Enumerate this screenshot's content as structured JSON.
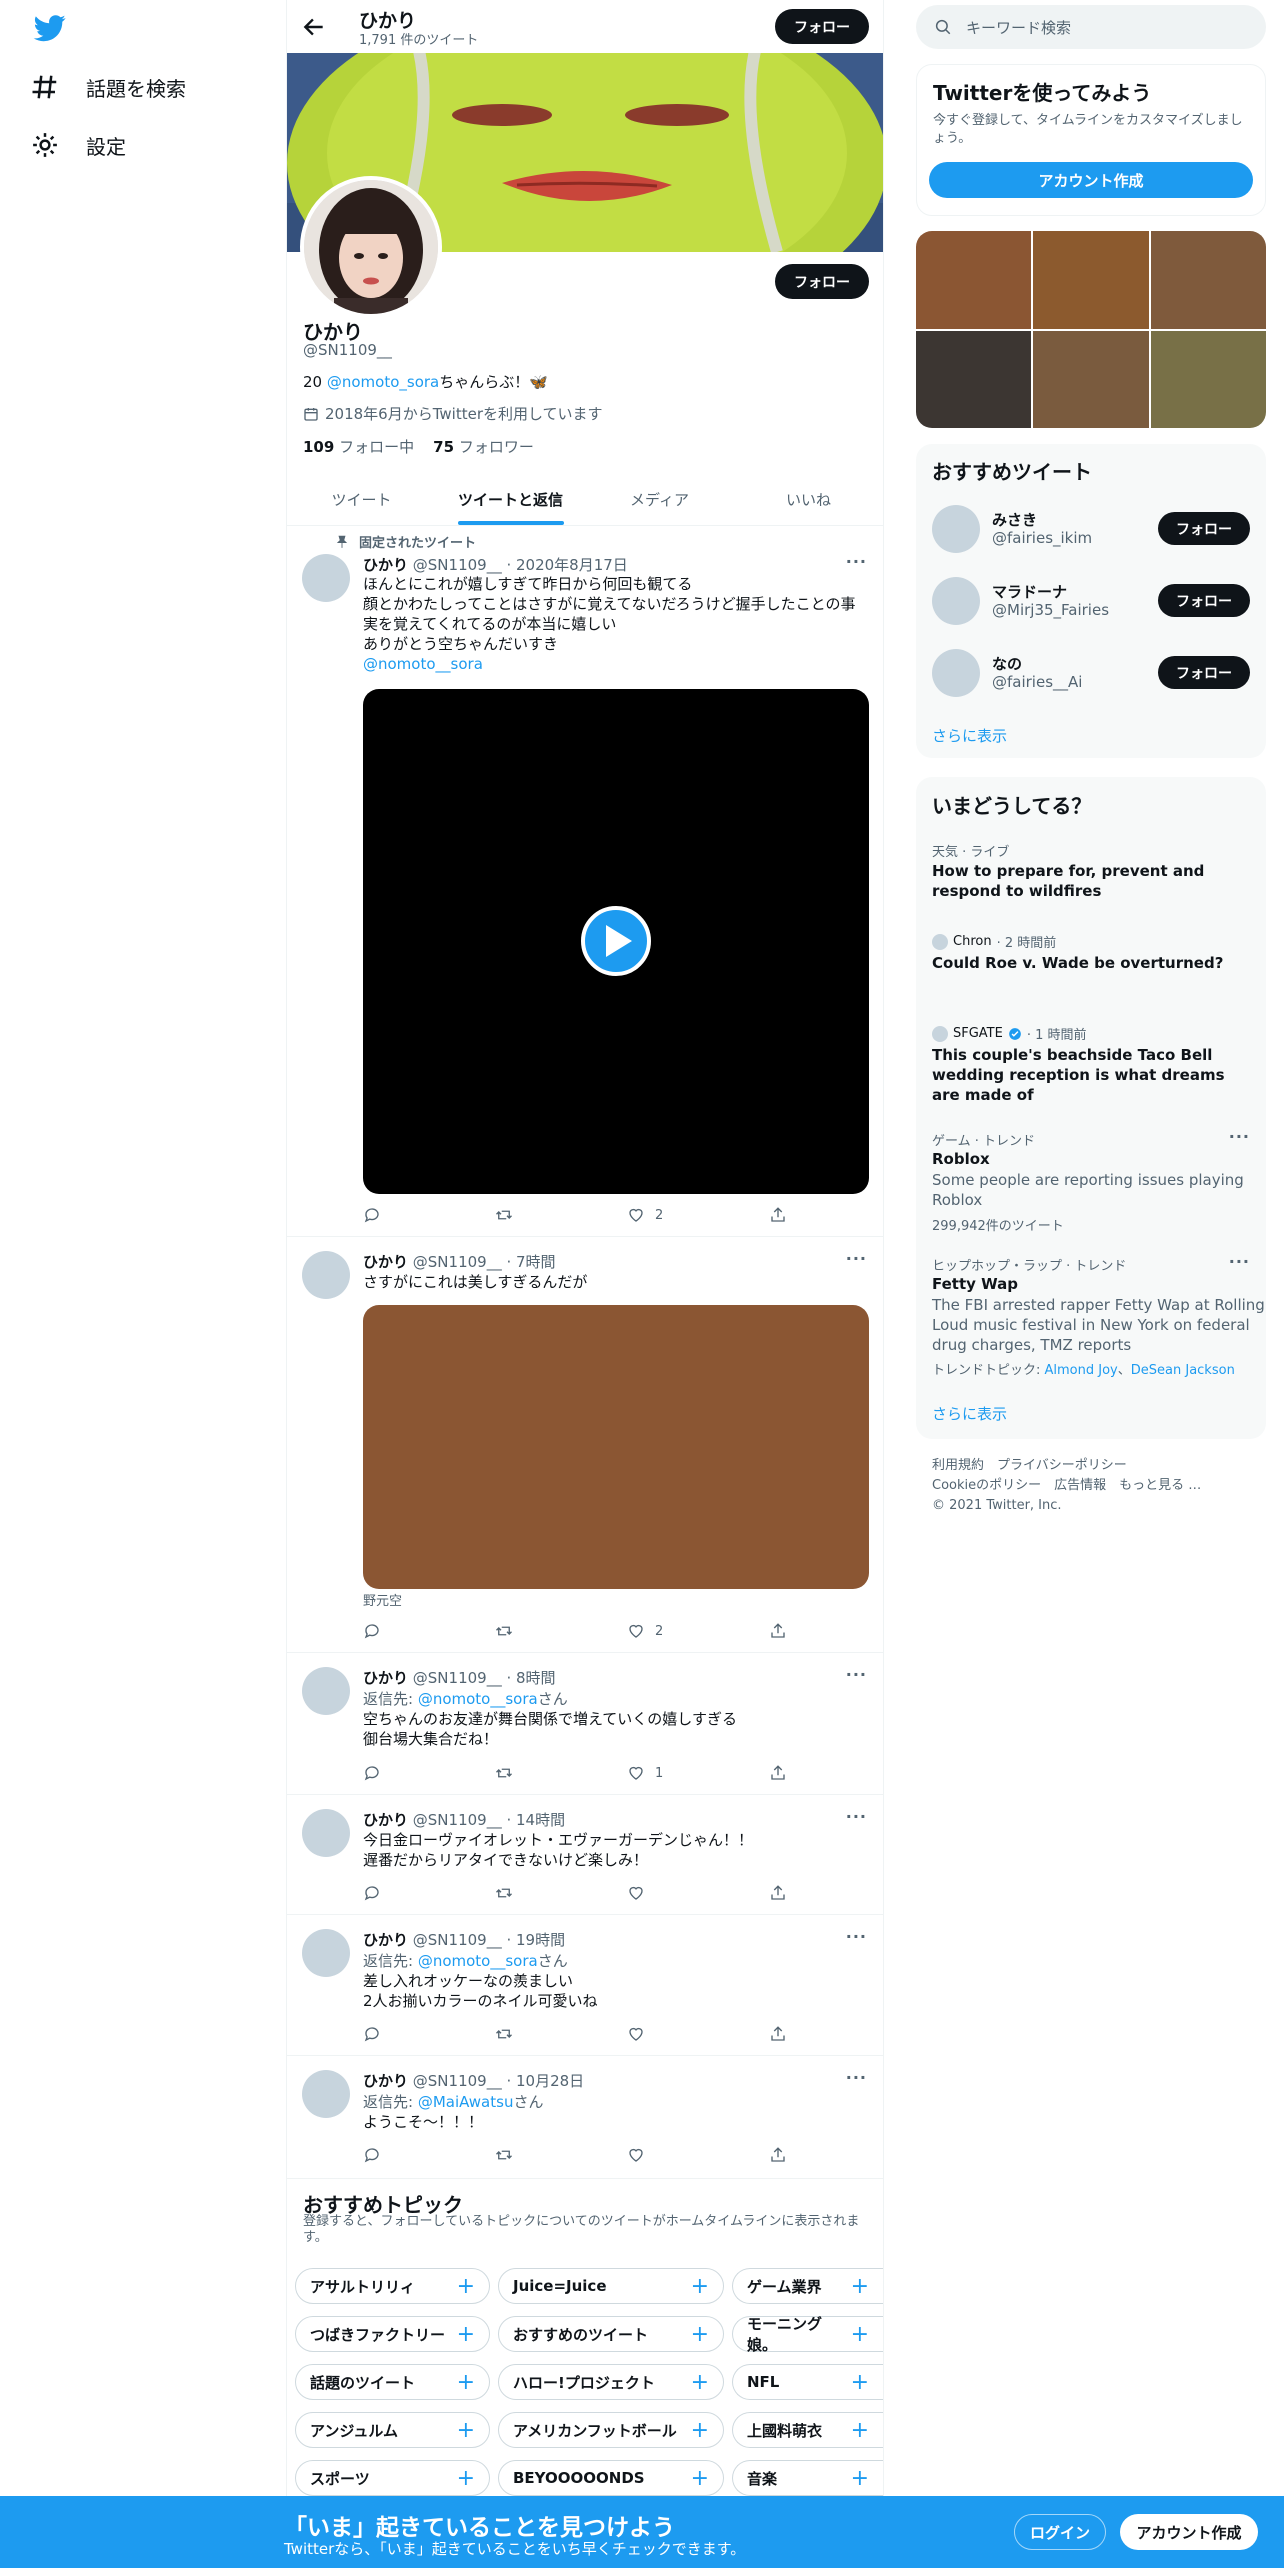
{
  "left_nav": {
    "items": [
      {
        "icon": "hashtag-icon",
        "label": "話題を検索"
      },
      {
        "icon": "gear-icon",
        "label": "設定"
      }
    ]
  },
  "header": {
    "name": "ひかり",
    "tweet_count": "1,791 件のツイート",
    "follow_label": "フォロー"
  },
  "profile": {
    "name": "ひかり",
    "handle": "@SN1109__",
    "bio_prefix": "20 ",
    "bio_mention": "@nomoto_sora",
    "bio_suffix": "ちゃんらぶ！🦋",
    "joined": "2018年6月からTwitterを利用しています",
    "following_count": "109",
    "following_label": " フォロー中",
    "followers_count": "75",
    "followers_label": " フォロワー",
    "follow_label": "フォロー"
  },
  "tabs": [
    "ツイート",
    "ツイートと返信",
    "メディア",
    "いいね"
  ],
  "pinned_label": "固定されたツイート",
  "tweets": [
    {
      "name": "ひかり",
      "meta": " @SN1109__ · 2020年8月17日",
      "text": "ほんとにこれが嬉しすぎて昨日から何回も観てる\n顔とかわたしってことはさすがに覚えてないだろうけど握手したことの事\n実を覚えてくれてるのが本当に嬉しい\nありがとう空ちゃんだいすき",
      "link": "@nomoto__sora",
      "likes": "2"
    },
    {
      "name": "ひかり",
      "meta": " @SN1109__ · 7時間",
      "text": "さすがにこれは美しすぎるんだが",
      "caption": "野元空",
      "likes": "2"
    },
    {
      "name": "ひかり",
      "meta": " @SN1109__ · 8時間",
      "reply_prefix": "返信先: ",
      "reply_to": "@nomoto__sora",
      "reply_suffix": "さん",
      "text": "空ちゃんのお友達が舞台関係で増えていくの嬉しすぎる\n御台場大集合だね！",
      "likes": "1"
    },
    {
      "name": "ひかり",
      "meta": " @SN1109__ · 14時間",
      "text": "今日金ローヴァイオレット・エヴァーガーデンじゃん！！\n遅番だからリアタイできないけど楽しみ！"
    },
    {
      "name": "ひかり",
      "meta": " @SN1109__ · 19時間",
      "reply_prefix": "返信先: ",
      "reply_to": "@nomoto__sora",
      "reply_suffix": "さん",
      "text": "差し入れオッケーなの羨ましい\n2人お揃いカラーのネイル可愛いね"
    },
    {
      "name": "ひかり",
      "meta": " @SN1109__ · 10月28日",
      "reply_prefix": "返信先: ",
      "reply_to": "@MaiAwatsu",
      "reply_suffix": "さん",
      "text": "ようこそ〜！！！"
    }
  ],
  "topics": {
    "title": "おすすめトピック",
    "subtitle": "登録すると、フォローしているトピックについてのツイートがホームタイムラインに表示されます。",
    "items": [
      "アサルトリリィ",
      "Juice=Juice",
      "ゲーム業界",
      "つばきファクトリー",
      "おすすめのツイート",
      "モーニング娘。",
      "話題のツイート",
      "ハロー!プロジェクト",
      "NFL",
      "アンジュルム",
      "アメリカンフットボール",
      "上國料萌衣",
      "スポーツ",
      "BEYOOOOONDS",
      "音楽"
    ]
  },
  "right": {
    "search_placeholder": "キーワード検索",
    "signup_title": "Twitterを使ってみよう",
    "signup_text": "今すぐ登録して、タイムラインをカスタマイズしましょう。",
    "signup_button": "アカウント作成",
    "suggest_title": "おすすめツイート",
    "suggestions": [
      {
        "name": "みさき",
        "handle": "@fairies_ikim"
      },
      {
        "name": "マラドーナ",
        "handle": "@Mirj35_Fairies"
      },
      {
        "name": "なの",
        "handle": "@fairies__Ai"
      }
    ],
    "follow_label": "フォロー",
    "show_more": "さらに表示",
    "trends_title": "いまどうしてる？",
    "trends": [
      {
        "meta": "天気 · ライブ",
        "title": "How to prepare for, prevent and\nrespond to wildfires"
      },
      {
        "source": "Chron",
        "meta": " · 2 時間前",
        "title": "Could Roe v. Wade be overturned?"
      },
      {
        "source": "SFGATE",
        "meta": " · 1 時間前",
        "title": "This couple's beachside Taco Bell\nwedding reception is what dreams\nare made of"
      },
      {
        "meta": "ゲーム · トレンド",
        "title": "Roblox",
        "desc": "Some people are reporting issues playing\nRoblox",
        "count": "299,942件のツイート"
      },
      {
        "meta": "ヒップホップ・ラップ · トレンド",
        "title": "Fetty Wap",
        "desc": "The FBI arrested rapper Fetty Wap at Rolling\nLoud music festival in New York on federal\ndrug charges, TMZ reports",
        "topic_prefix": "トレンドトピック: ",
        "topic1": "Almond Joy",
        "topic_sep": "、",
        "topic2": "DeSean Jackson"
      }
    ],
    "trends_more": "さらに表示",
    "footer_line1": "利用規約　プライバシーポリシー",
    "footer_line2": "Cookieのポリシー　広告情報　もっと見る …",
    "footer_line3": "© 2021 Twitter, Inc."
  },
  "bottom_bar": {
    "title": "「いま」起きていることを見つけよう",
    "subtitle": "Twitterなら、「いま」起きていることをいち早くチェックできます。",
    "login": "ログイン",
    "signup": "アカウント作成"
  },
  "colors": {
    "accent": "#1d9bf0",
    "text": "#0f1419",
    "muted": "#536471"
  }
}
